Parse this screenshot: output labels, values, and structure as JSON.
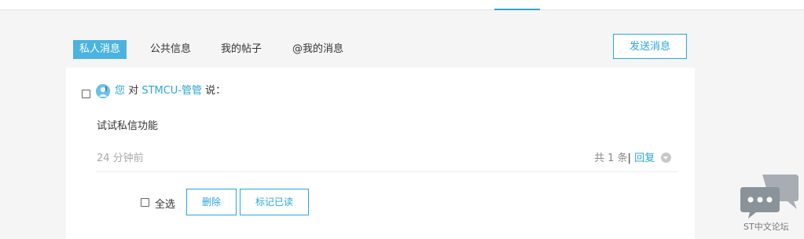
{
  "tabs": [
    {
      "label": "私人消息",
      "active": true
    },
    {
      "label": "公共信息",
      "active": false
    },
    {
      "label": "我的帖子",
      "active": false
    },
    {
      "label": "@我的消息",
      "active": false
    }
  ],
  "send_button": "发送消息",
  "message": {
    "you": "您",
    "to_word": "对",
    "recipient": "STMCU-管管",
    "says": "说：",
    "body": "试试私信功能",
    "time": "24 分钟前",
    "count_text": "共 1 条",
    "reply": "回复"
  },
  "bulk": {
    "select_all": "全选",
    "delete": "删除",
    "mark_read": "标记已读"
  },
  "forum_badge_label": "ST中文论坛",
  "colors": {
    "accent": "#2aa6d8",
    "active_tab": "#4ab3e0"
  }
}
